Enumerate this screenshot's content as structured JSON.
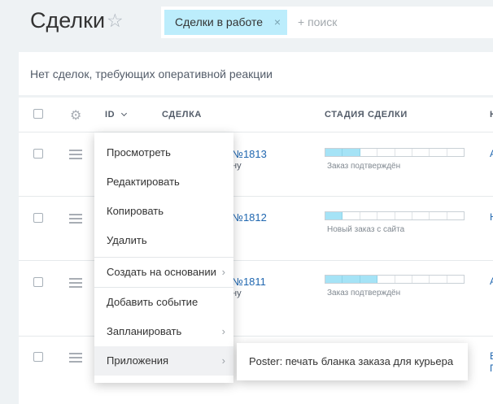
{
  "header": {
    "title": "Сделки",
    "star_icon": "star-icon",
    "filter_chip": "Сделки в работе",
    "filter_chip_close": "×",
    "search_placeholder": "+ поиск"
  },
  "notice": "Нет сделок, требующих оперативной реакции",
  "table": {
    "columns": {
      "id": "ID",
      "deal": "СДЕЛКА",
      "stage": "СТАДИЯ СДЕЛКИ",
      "next": "Н"
    },
    "rows": [
      {
        "deal_number": "№1813",
        "deal_sub": "ну",
        "stage_label": "Заказ подтверждён",
        "stage_filled": 2,
        "edge": "А"
      },
      {
        "deal_number": "№1812",
        "deal_sub": "",
        "stage_label": "Новый заказ с сайта",
        "stage_filled": 1,
        "edge": "Н"
      },
      {
        "deal_number": "№1811",
        "deal_sub": "ну",
        "stage_label": "Заказ подтверждён",
        "stage_filled": 3,
        "edge": "А"
      },
      {
        "deal_number": "",
        "deal_sub": "",
        "stage_label": "",
        "stage_filled": 0,
        "edge": "В",
        "edge2": "П"
      }
    ]
  },
  "context_menu": {
    "items": [
      {
        "label": "Просмотреть",
        "has_submenu": false
      },
      {
        "label": "Редактировать",
        "has_submenu": false
      },
      {
        "label": "Копировать",
        "has_submenu": false
      },
      {
        "label": "Удалить",
        "has_submenu": false
      },
      {
        "label": "Создать на основании",
        "has_submenu": true
      },
      {
        "label": "Добавить событие",
        "has_submenu": false
      },
      {
        "label": "Запланировать",
        "has_submenu": true
      },
      {
        "label": "Приложения",
        "has_submenu": true
      }
    ],
    "highlighted": "Приложения"
  },
  "submenu": {
    "item": "Poster: печать бланка заказа для курьера"
  },
  "colors": {
    "accent_chip": "#bcedfc",
    "stage_fill": "#a5e3f6",
    "link": "#2067b0"
  }
}
